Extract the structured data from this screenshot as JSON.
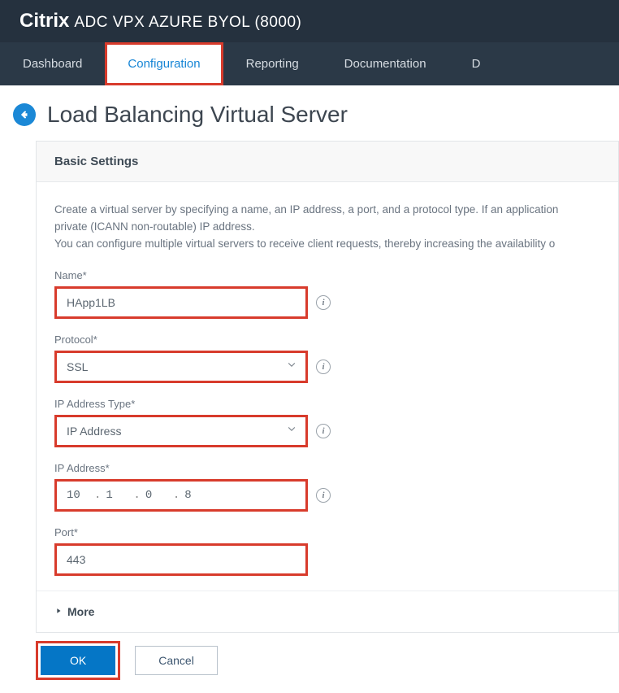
{
  "header": {
    "brand_bold": "Citrix",
    "brand_rest": "ADC VPX AZURE BYOL (8000)"
  },
  "nav": {
    "tabs": [
      "Dashboard",
      "Configuration",
      "Reporting",
      "Documentation",
      "D"
    ]
  },
  "page": {
    "title": "Load Balancing Virtual Server"
  },
  "panel": {
    "title": "Basic Settings",
    "description_line1": "Create a virtual server by specifying a name, an IP address, a port, and a protocol type. If an application",
    "description_line2": "private (ICANN non-routable) IP address.",
    "description_line3": "You can configure multiple virtual servers to receive client requests, thereby increasing the availability o"
  },
  "form": {
    "name_label": "Name*",
    "name_value": "HApp1LB",
    "protocol_label": "Protocol*",
    "protocol_value": "SSL",
    "ip_type_label": "IP Address Type*",
    "ip_type_value": "IP Address",
    "ip_label": "IP Address*",
    "ip_oct1": "10",
    "ip_oct2": "1",
    "ip_oct3": "0",
    "ip_oct4": "8",
    "port_label": "Port*",
    "port_value": "443",
    "more_label": "More"
  },
  "buttons": {
    "ok": "OK",
    "cancel": "Cancel"
  }
}
